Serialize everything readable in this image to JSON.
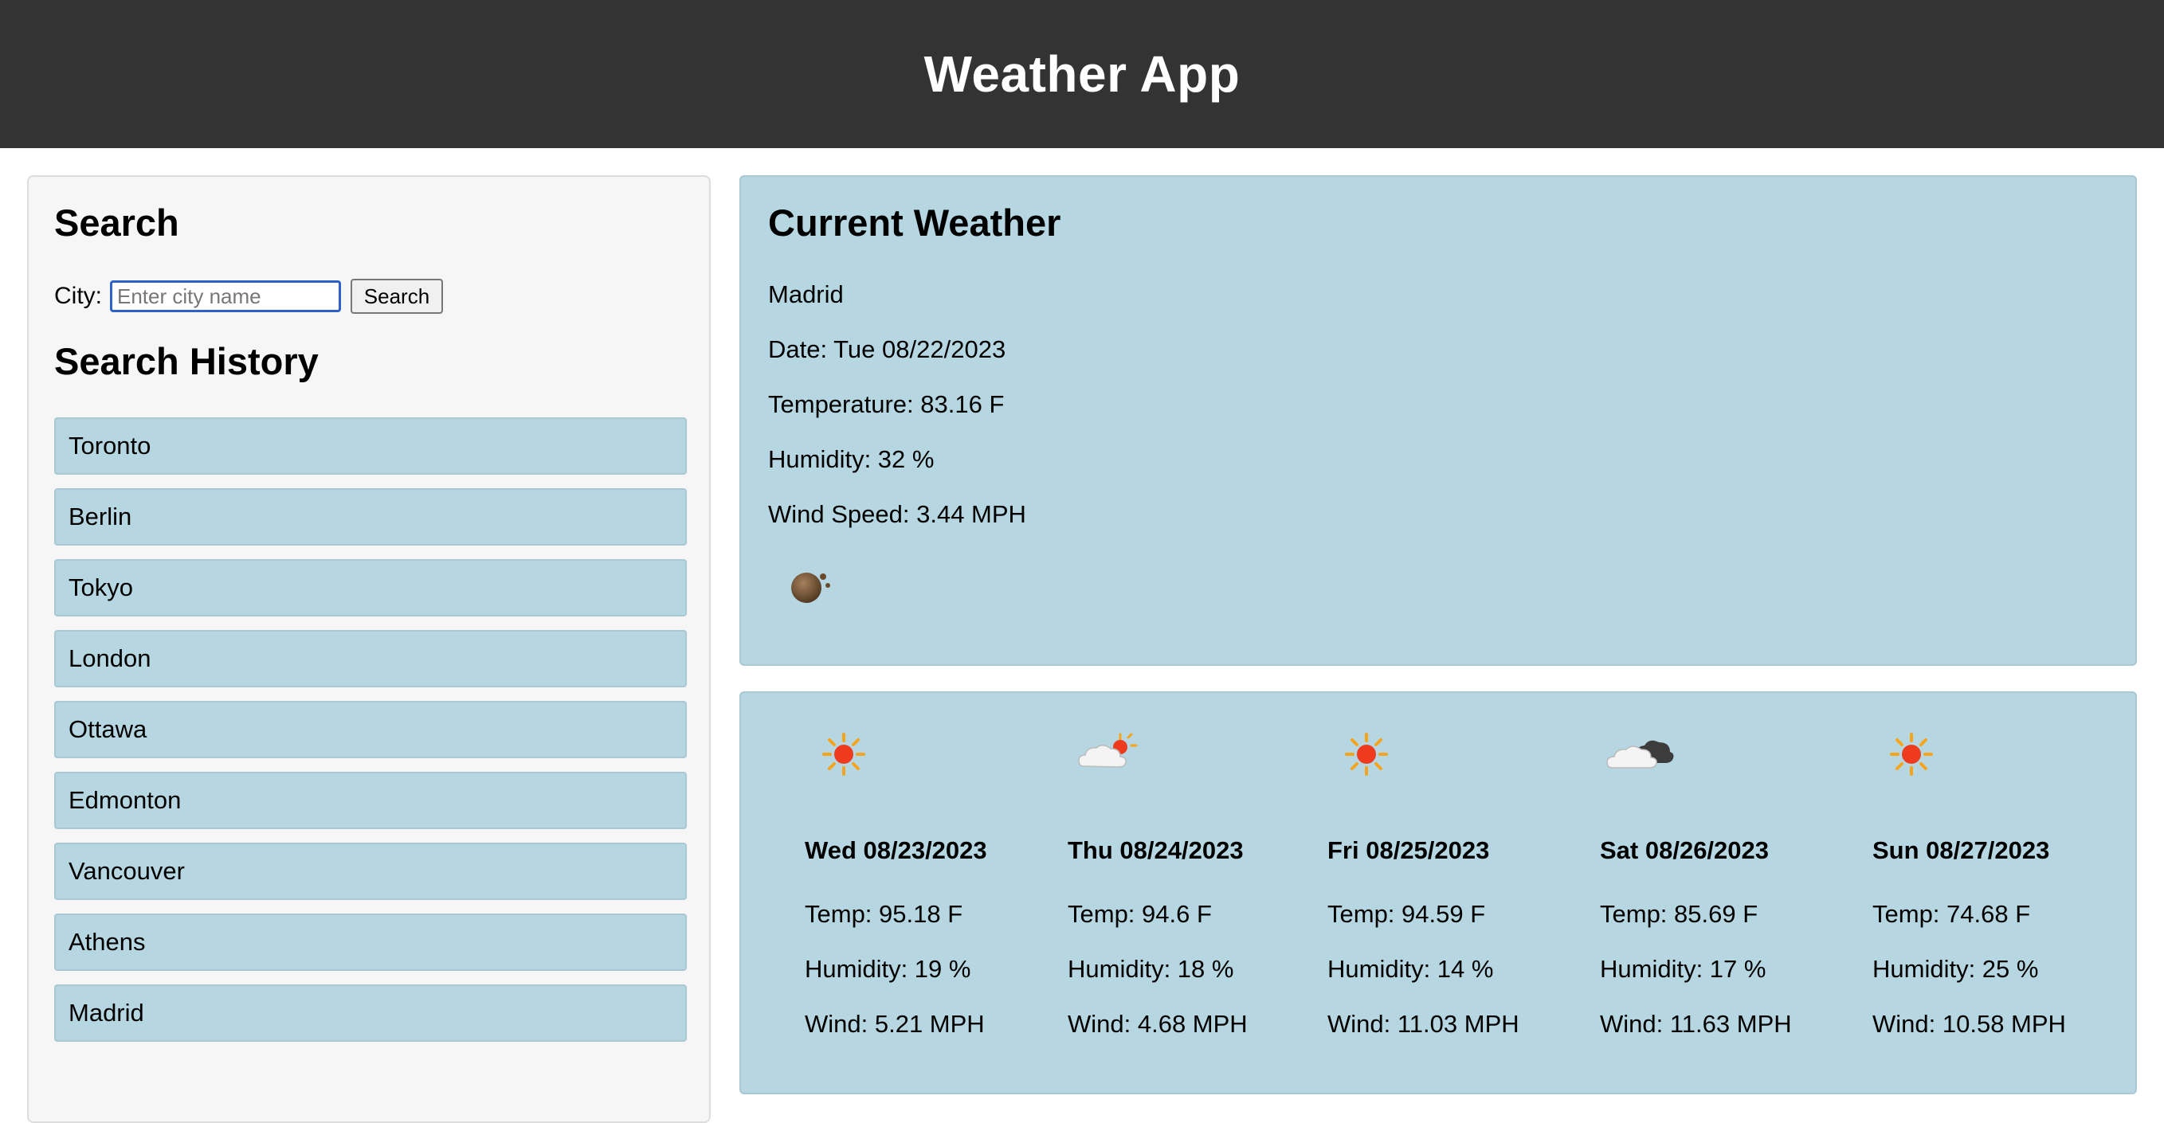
{
  "header": {
    "title": "Weather App"
  },
  "sidebar": {
    "search_heading": "Search",
    "city_label": "City:",
    "city_placeholder": "Enter city name",
    "city_value": "",
    "search_button": "Search",
    "history_heading": "Search History",
    "history": [
      "Toronto",
      "Berlin",
      "Tokyo",
      "London",
      "Ottawa",
      "Edmonton",
      "Vancouver",
      "Athens",
      "Madrid"
    ]
  },
  "current": {
    "heading": "Current Weather",
    "city": "Madrid",
    "date": "Date: Tue 08/22/2023",
    "temperature": "Temperature: 83.16 F",
    "humidity": "Humidity: 32 %",
    "wind": "Wind Speed: 3.44 MPH",
    "icon": "smoke-icon"
  },
  "forecast": [
    {
      "date": "Wed 08/23/2023",
      "temp": "Temp: 95.18 F",
      "humidity": "Humidity: 19 %",
      "wind": "Wind: 5.21 MPH",
      "icon": "sun-icon"
    },
    {
      "date": "Thu 08/24/2023",
      "temp": "Temp: 94.6 F",
      "humidity": "Humidity: 18 %",
      "wind": "Wind: 4.68 MPH",
      "icon": "partly-cloudy-icon"
    },
    {
      "date": "Fri 08/25/2023",
      "temp": "Temp: 94.59 F",
      "humidity": "Humidity: 14 %",
      "wind": "Wind: 11.03 MPH",
      "icon": "sun-icon"
    },
    {
      "date": "Sat 08/26/2023",
      "temp": "Temp: 85.69 F",
      "humidity": "Humidity: 17 %",
      "wind": "Wind: 11.63 MPH",
      "icon": "clouds-icon"
    },
    {
      "date": "Sun 08/27/2023",
      "temp": "Temp: 74.68 F",
      "humidity": "Humidity: 25 %",
      "wind": "Wind: 10.58 MPH",
      "icon": "sun-icon"
    }
  ],
  "colors": {
    "header_bg": "#333333",
    "panel_bg": "#b6d7e2",
    "sidebar_bg": "#f6f6f6"
  }
}
